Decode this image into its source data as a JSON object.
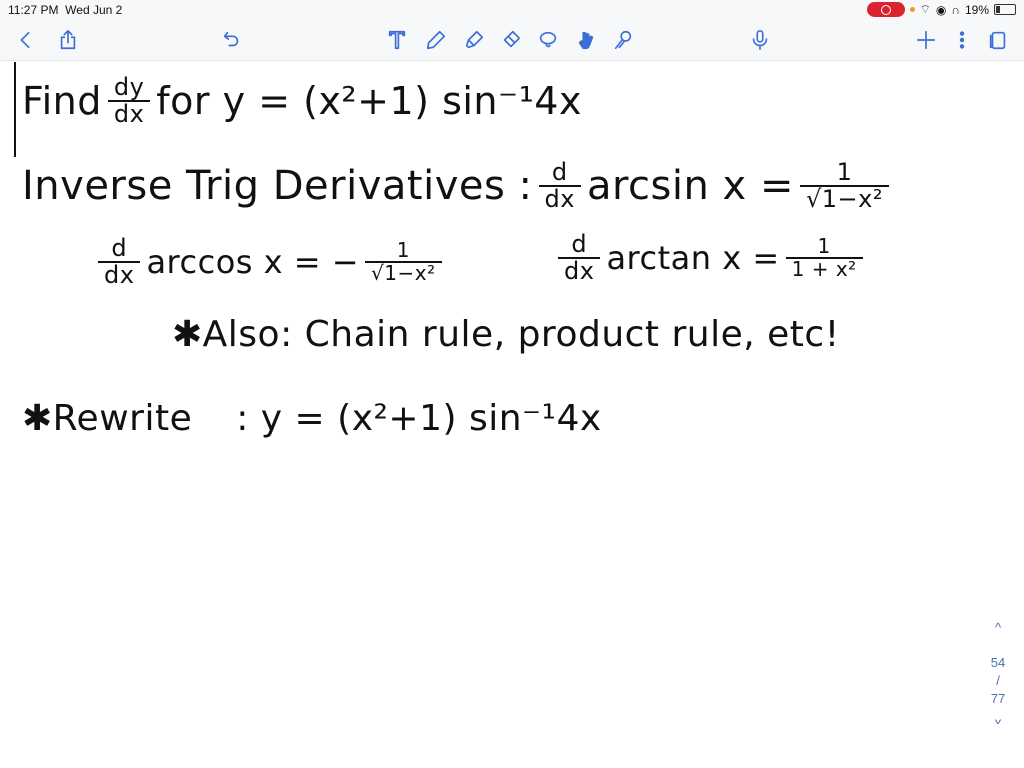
{
  "status_bar": {
    "time": "11:27 PM",
    "date": "Wed Jun 2",
    "battery": "19%",
    "battery_level": 0.19,
    "recording_color": "#d9242f"
  },
  "toolbar": {
    "icons": [
      "back-icon",
      "share-icon",
      "undo-icon",
      "text-tool-icon",
      "pen-icon",
      "highlighter-icon",
      "eraser-icon",
      "lasso-icon",
      "hand-pointer-icon",
      "laser-pointer-icon",
      "microphone-icon",
      "add-icon",
      "more-icon",
      "pages-icon"
    ],
    "active_tool": "hand-pointer-icon",
    "accent": "#3b6fd6"
  },
  "notes": {
    "line1": {
      "find": "Find",
      "num": "dy",
      "den": "dx",
      "rest": "for y = (x²+1) sin⁻¹4x"
    },
    "line2": {
      "label": "Inverse Trig Derivatives :",
      "d": "d",
      "dx": "dx",
      "fn": "arcsin x =",
      "num": "1",
      "den": "√1−x²"
    },
    "line3a": {
      "d": "d",
      "dx": "dx",
      "fn": "arccos x = −",
      "num": "1",
      "den": "√1−x²"
    },
    "line3b": {
      "d": "d",
      "dx": "dx",
      "fn": "arctan x =",
      "num": "1",
      "den": "1 + x²"
    },
    "line4": "✱Also: Chain rule, product rule, etc!",
    "line5": {
      "label": "✱Rewrite",
      "rest": ":  y = (x²+1) sin⁻¹4x"
    }
  },
  "pager": {
    "up": "^",
    "current": "54",
    "sep": "/",
    "total": "77",
    "down": "v"
  }
}
